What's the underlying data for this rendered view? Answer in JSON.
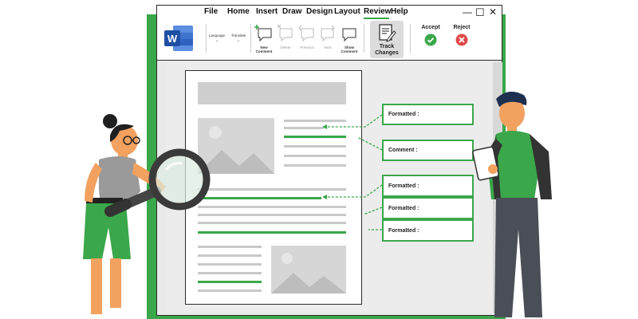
{
  "menu": {
    "items": [
      "File",
      "Home",
      "Insert",
      "Draw",
      "Design",
      "Layout",
      "Review",
      "Help"
    ],
    "active": "Review"
  },
  "window_controls": {
    "minimize": "—",
    "maximize": "☐",
    "close": "✕"
  },
  "ribbon": {
    "language": "Language",
    "translate": "Translate",
    "new_comment": "New Comment",
    "delete": "Delete",
    "previous": "Previous",
    "next": "Next",
    "show_comment": "Show Comment",
    "track_changes": "Track Changes",
    "accept": "Accept",
    "reject": "Reject"
  },
  "callouts": [
    "Formatted :",
    "Comment :",
    "Formatted :",
    "Formatted :",
    "Formatted :"
  ],
  "colors": {
    "accent": "#3aa74a",
    "reject": "#e04a4a",
    "word_blue": "#2b5bb8"
  },
  "icons": {
    "app": "word-logo-icon",
    "accept": "check-circle-icon",
    "reject": "x-circle-icon",
    "track_changes": "document-edit-icon",
    "search": "magnifier-icon"
  }
}
